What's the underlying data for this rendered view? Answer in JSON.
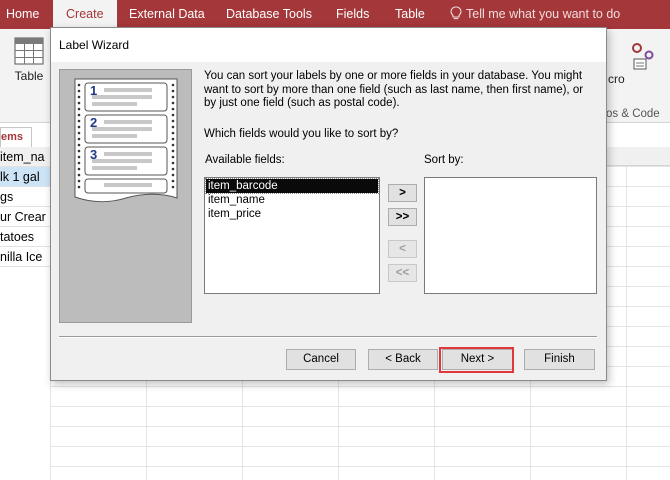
{
  "ribbon": {
    "tabs": [
      {
        "label": "Home"
      },
      {
        "label": "Create"
      },
      {
        "label": "External Data"
      },
      {
        "label": "Database Tools"
      },
      {
        "label": "Fields"
      },
      {
        "label": "Table"
      }
    ],
    "active_tab": "Create",
    "tell_me": "Tell me what you want to do",
    "table_button": "Table",
    "macro_label": "cro",
    "group_label": "os & Code",
    "colors": {
      "accent": "#a4373a",
      "highlight": "#e0383c"
    }
  },
  "nav": {
    "tab_label": "ems",
    "rows": [
      "item_na",
      "lk 1 gal",
      "gs",
      "ur Crear",
      "tatoes",
      "nilla Ice"
    ]
  },
  "dialog": {
    "title": "Label Wizard",
    "intro": "You can sort your labels by one or more fields in your database.  You might want to sort by more than one field (such as last name, then first name), or by just one field (such as postal code).",
    "question": "Which fields would you like to sort by?",
    "available_label": "Available fields:",
    "sortby_label": "Sort by:",
    "available_fields": [
      "item_barcode",
      "item_name",
      "item_price"
    ],
    "selected_field": "item_barcode",
    "illustration_numbers": [
      "1",
      "2",
      "3"
    ],
    "buttons": {
      "add_one": ">",
      "add_all": ">>",
      "remove_one": "<",
      "remove_all": "<<",
      "cancel": "Cancel",
      "back": "< Back",
      "next": "Next >",
      "finish": "Finish"
    }
  }
}
